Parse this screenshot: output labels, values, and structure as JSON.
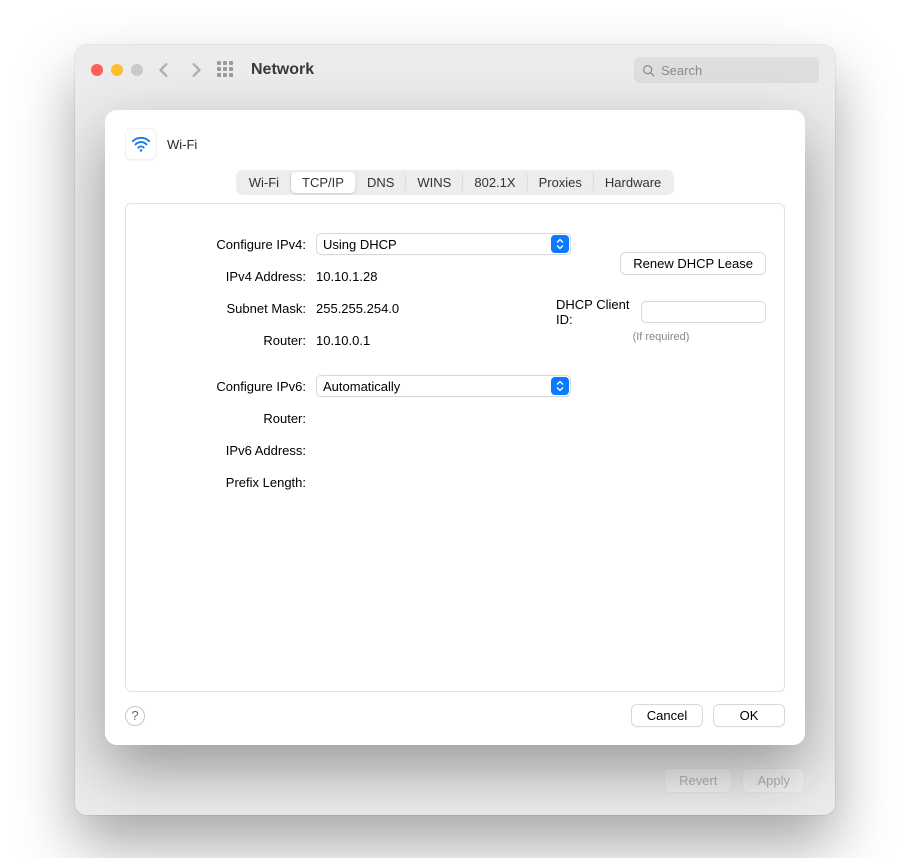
{
  "window": {
    "title": "Network",
    "search_placeholder": "Search"
  },
  "bottom": {
    "revert": "Revert",
    "apply": "Apply"
  },
  "sheet": {
    "title": "Wi-Fi",
    "tabs": [
      "Wi-Fi",
      "TCP/IP",
      "DNS",
      "WINS",
      "802.1X",
      "Proxies",
      "Hardware"
    ],
    "active_tab": "TCP/IP",
    "labels": {
      "configure_ipv4": "Configure IPv4:",
      "ipv4_address": "IPv4 Address:",
      "subnet_mask": "Subnet Mask:",
      "router4": "Router:",
      "configure_ipv6": "Configure IPv6:",
      "router6": "Router:",
      "ipv6_address": "IPv6 Address:",
      "prefix_length": "Prefix Length:",
      "dhcp_client_id": "DHCP Client ID:"
    },
    "values": {
      "configure_ipv4": "Using DHCP",
      "ipv4_address": "10.10.1.28",
      "subnet_mask": "255.255.254.0",
      "router4": "10.10.0.1",
      "configure_ipv6": "Automatically",
      "router6": "",
      "ipv6_address": "",
      "prefix_length": "",
      "dhcp_client_id": ""
    },
    "buttons": {
      "renew": "Renew DHCP Lease",
      "cancel": "Cancel",
      "ok": "OK",
      "help": "?"
    },
    "hint": "(If required)"
  }
}
